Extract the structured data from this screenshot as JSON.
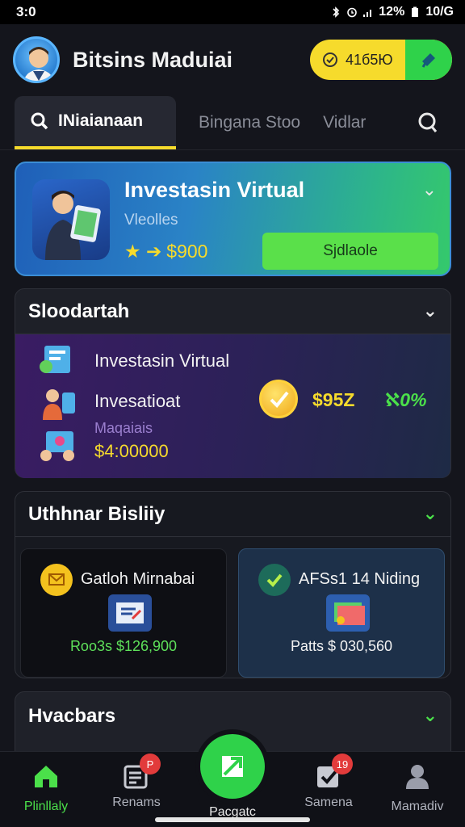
{
  "status_bar": {
    "time": "3:0",
    "battery": "12%",
    "network": "10/G"
  },
  "header": {
    "title": "Bitsins Maduiai",
    "balance": "41б5Ю"
  },
  "tabs": {
    "active": "INiaianaan",
    "second": "Bingana Stoo",
    "third": "Vidlar"
  },
  "hero": {
    "title": "Investasin Virtual",
    "subtitle": "Vleolles",
    "amount": "$900",
    "button": "Sjdlaole"
  },
  "section1": {
    "title": "Sloodartah",
    "items": [
      {
        "label": "Investasin Virtual"
      },
      {
        "label": "Invesatioat"
      }
    ],
    "small_label": "Maqaiais",
    "money": "$4:00000",
    "amount": "$95Z",
    "percent": "ℵ0%"
  },
  "section2": {
    "title": "Uthhnar Bisliiy",
    "card_left": {
      "title": "Gatloh Mirnabai",
      "value": "Roo3s $126,900"
    },
    "card_right": {
      "title": "AFSs1 14 Niding",
      "value": "Patts $ 030,560"
    }
  },
  "section3": {
    "title": "Hvacbars"
  },
  "nav": {
    "home": "Plinllaly",
    "items": "Renams",
    "center": "Pacgatc",
    "center_badge": "",
    "tasks": "Samena",
    "profile": "Mamadiv",
    "badge_items": "P",
    "badge_tasks": "19"
  },
  "colors": {
    "accent_yellow": "#f6db2c",
    "accent_green": "#2fd24a",
    "background": "#14151c"
  }
}
